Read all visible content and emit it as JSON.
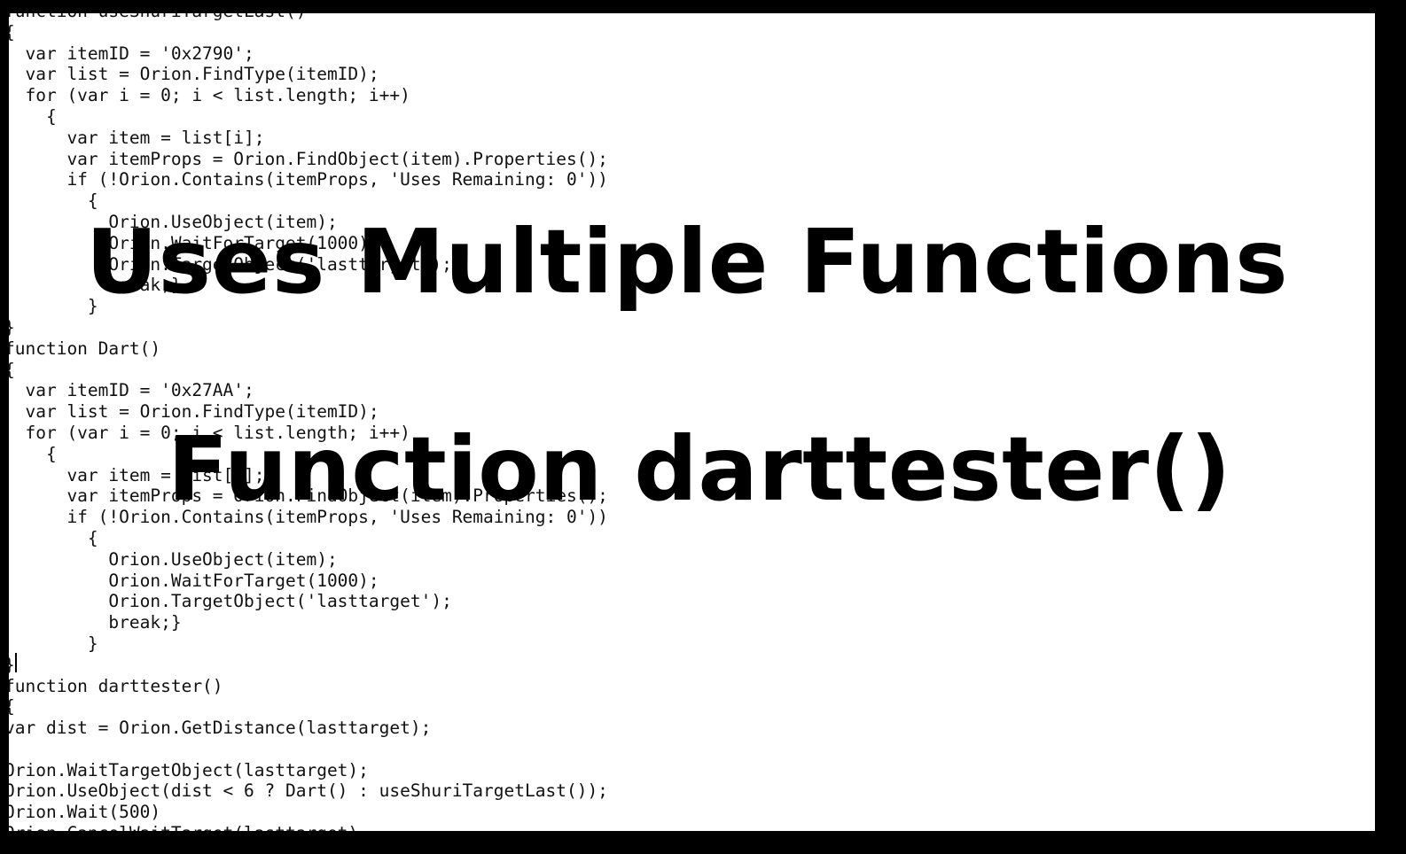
{
  "editor": {
    "code_lines": [
      "function useShuriTargetLast()",
      "{",
      "  var itemID = '0x2790';",
      "  var list = Orion.FindType(itemID);",
      "  for (var i = 0; i < list.length; i++)",
      "    {",
      "      var item = list[i];",
      "      var itemProps = Orion.FindObject(item).Properties();",
      "      if (!Orion.Contains(itemProps, 'Uses Remaining: 0'))",
      "        {",
      "          Orion.UseObject(item);",
      "          Orion.WaitForTarget(1000);",
      "          Orion.TargetObject('lasttarget');",
      "          break;}",
      "        }",
      "}",
      "function Dart()",
      "{",
      "  var itemID = '0x27AA';",
      "  var list = Orion.FindType(itemID);",
      "  for (var i = 0; i < list.length; i++)",
      "    {",
      "      var item = list[i];",
      "      var itemProps = Orion.FindObject(item).Properties();",
      "      if (!Orion.Contains(itemProps, 'Uses Remaining: 0'))",
      "        {",
      "          Orion.UseObject(item);",
      "          Orion.WaitForTarget(1000);",
      "          Orion.TargetObject('lasttarget');",
      "          break;}",
      "        }",
      "}",
      "function darttester()",
      "{",
      "var dist = Orion.GetDistance(lasttarget);",
      "",
      "Orion.WaitTargetObject(lasttarget);",
      "Orion.UseObject(dist < 6 ? Dart() : useShuriTargetLast());",
      "Orion.Wait(500)",
      "Orion.CancelWaitTarget(lasttarget)"
    ]
  },
  "overlay": {
    "title1": "Uses Multiple Functions",
    "title2": "Function darttester()"
  }
}
